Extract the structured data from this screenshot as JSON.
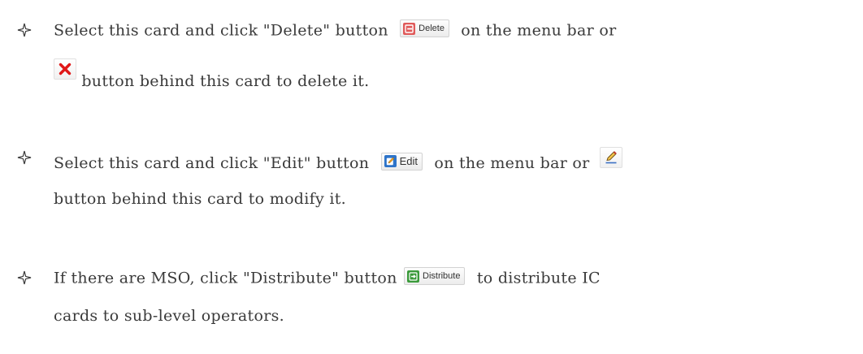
{
  "bullets": [
    {
      "line1_before": "Select this card and click \"Delete\" button",
      "button_label": "Delete",
      "line1_after": "on the menu bar or",
      "line2_after": "button behind this card to delete it.",
      "icon_only_name": "delete-x-icon"
    },
    {
      "line1_before": "Select this card and click \"Edit\" button",
      "button_label": "Edit",
      "line1_after": "on the menu bar or",
      "line2_text": "button behind this card to modify it.",
      "icon_only_name": "edit-pencil-icon"
    },
    {
      "line1_before": "If there are MSO, click \"Distribute\" button",
      "button_label": "Distribute",
      "line1_after": "to distribute IC",
      "line2_text": "cards to sub-level operators."
    }
  ],
  "icons": {
    "bullet": "four-point-star-bullet-icon",
    "delete": "delete-icon",
    "edit": "edit-icon",
    "distribute": "distribute-icon"
  },
  "colors": {
    "text": "#3a3a3a",
    "delete_red": "#e05a5a",
    "edit_blue": "#2e74c9",
    "distribute_green": "#3a9a3a",
    "x_red": "#e01818"
  }
}
